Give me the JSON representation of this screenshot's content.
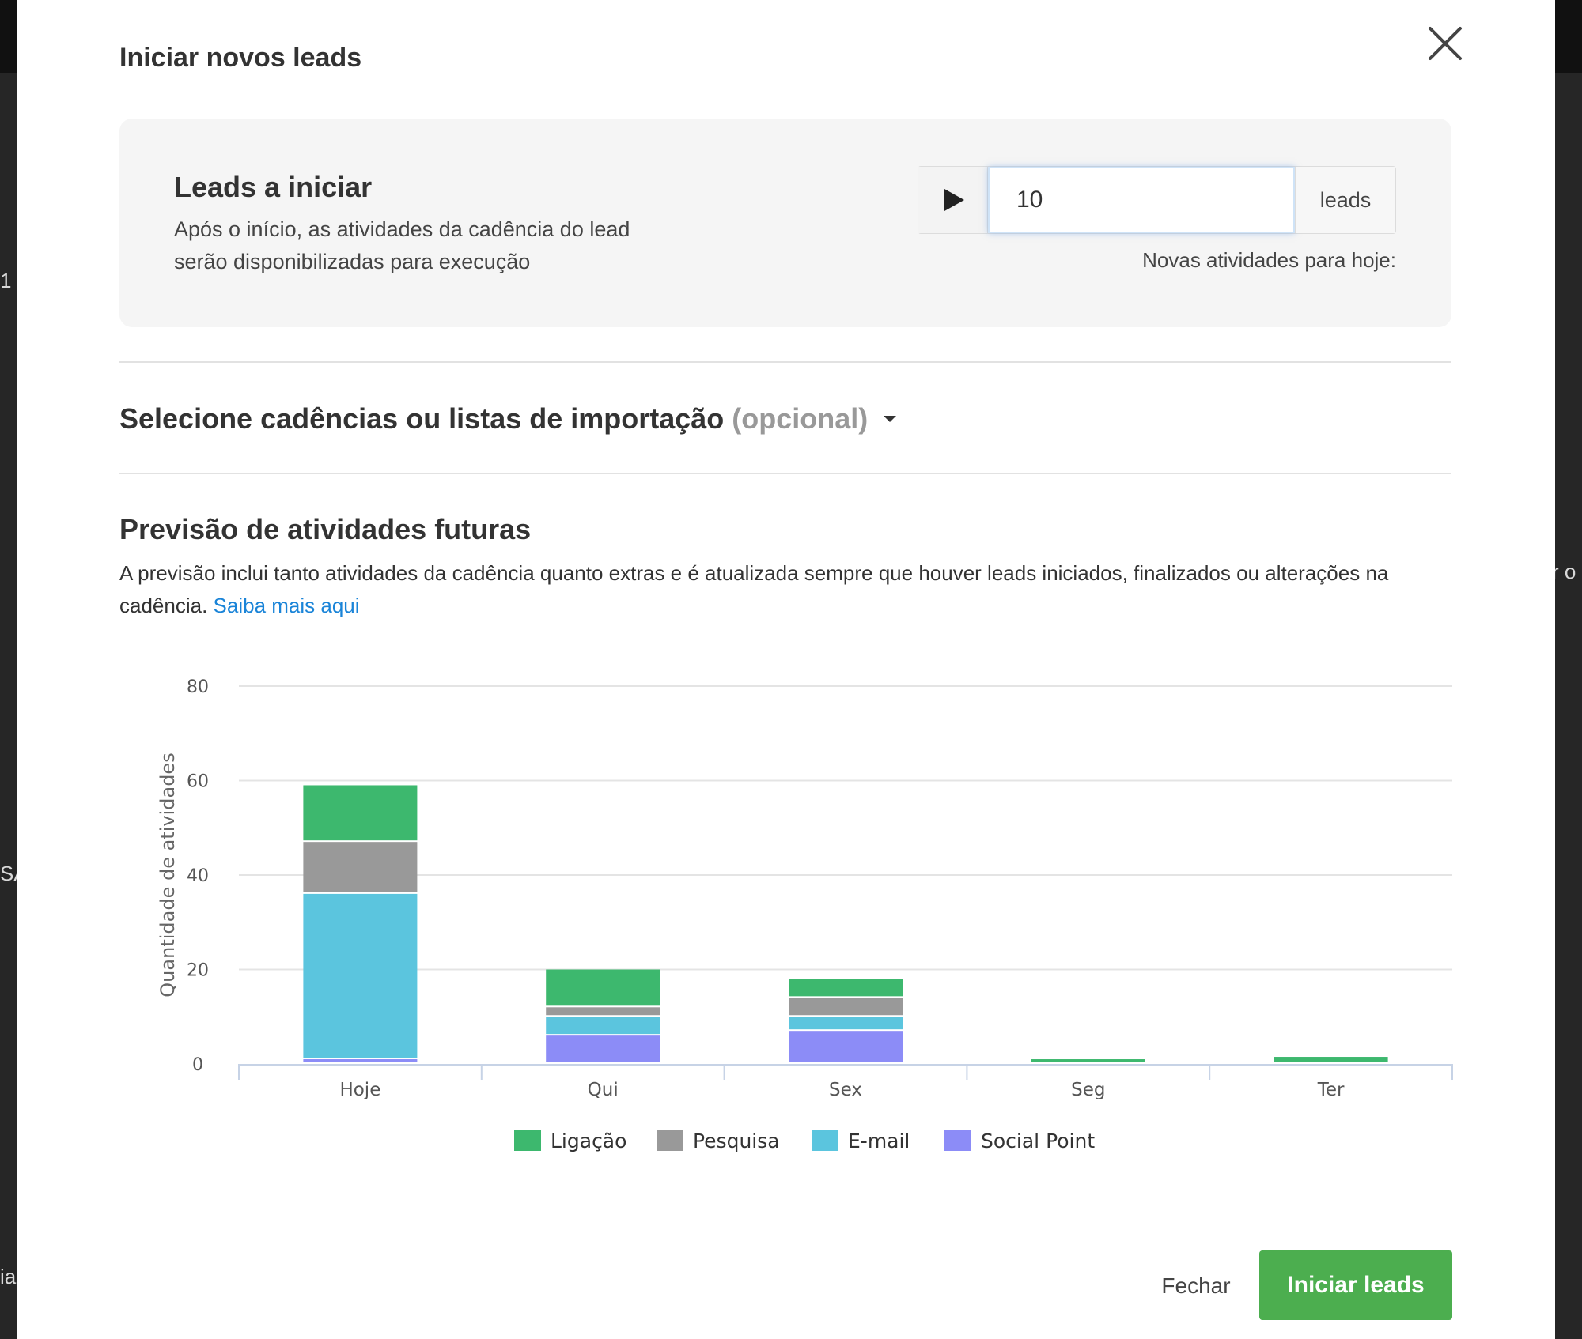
{
  "background": {
    "fragments": [
      "1",
      "SA",
      "r o",
      "ia"
    ]
  },
  "modal": {
    "title": "Iniciar novos leads",
    "leads_card": {
      "title": "Leads a iniciar",
      "description": "Após o início, as atividades da cadência do lead serão disponibilizadas para execução",
      "quantity_value": "10",
      "unit_label": "leads",
      "new_activities_label": "Novas atividades para hoje:"
    },
    "select": {
      "title": "Selecione cadências ou listas de importação",
      "optional": "(opcional)"
    },
    "forecast": {
      "title": "Previsão de atividades futuras",
      "description": "A previsão inclui tanto atividades da cadência quanto extras e é atualizada sempre que houver leads iniciados, finalizados ou alterações na cadência.",
      "link_label": "Saiba mais aqui"
    },
    "footer": {
      "close_label": "Fechar",
      "start_label": "Iniciar leads"
    }
  },
  "chart_data": {
    "type": "bar",
    "stacked": true,
    "categories": [
      "Hoje",
      "Qui",
      "Sex",
      "Seg",
      "Ter"
    ],
    "series": [
      {
        "name": "Social Point",
        "color": "#8c8cf7",
        "values": [
          1,
          6,
          7,
          0,
          0
        ]
      },
      {
        "name": "E-mail",
        "color": "#5bc5de",
        "values": [
          35,
          4,
          3,
          0,
          0
        ]
      },
      {
        "name": "Pesquisa",
        "color": "#999999",
        "values": [
          11,
          2,
          4,
          0,
          0
        ]
      },
      {
        "name": "Ligação",
        "color": "#3db86e",
        "values": [
          12,
          8,
          4,
          1,
          1.5
        ]
      }
    ],
    "legend_order": [
      "Ligação",
      "Pesquisa",
      "E-mail",
      "Social Point"
    ],
    "ylabel": "Quantidade de atividades",
    "xlabel": "",
    "ylim": [
      0,
      80
    ],
    "yticks": [
      0,
      20,
      40,
      60,
      80
    ],
    "grid": true,
    "legend_position": "bottom"
  }
}
